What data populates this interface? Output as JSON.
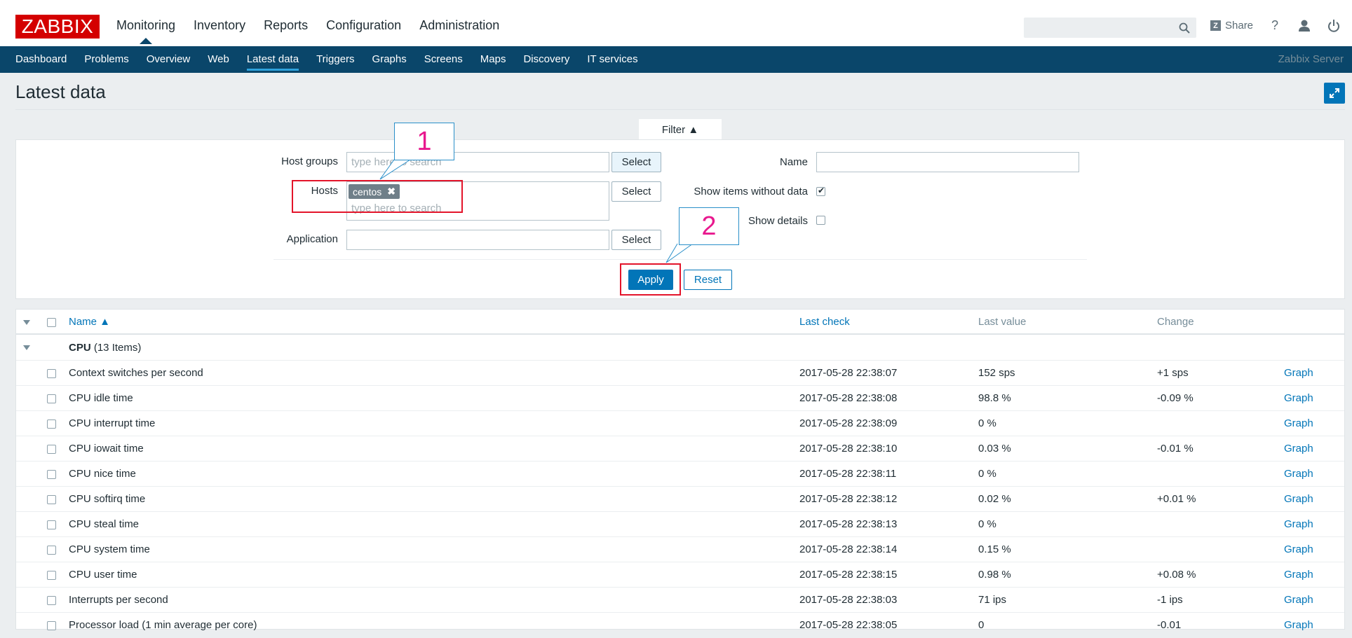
{
  "header": {
    "logo": "ZABBIX",
    "menu": [
      "Monitoring",
      "Inventory",
      "Reports",
      "Configuration",
      "Administration"
    ],
    "share_label": "Share",
    "share_badge": "Z",
    "help_label": "?"
  },
  "subnav": {
    "items": [
      "Dashboard",
      "Problems",
      "Overview",
      "Web",
      "Latest data",
      "Triggers",
      "Graphs",
      "Screens",
      "Maps",
      "Discovery",
      "IT services"
    ],
    "active": "Latest data",
    "server": "Zabbix Server"
  },
  "page": {
    "title": "Latest data"
  },
  "filter": {
    "tab_label": "Filter ▲",
    "host_groups_label": "Host groups",
    "host_groups_placeholder": "type here to search",
    "hosts_label": "Hosts",
    "hosts_tag": "centos",
    "hosts_placeholder": "type here to search",
    "application_label": "Application",
    "application_value": "",
    "select_label": "Select",
    "name_label": "Name",
    "name_value": "",
    "show_without_data_label": "Show items without data",
    "show_without_data_checked": true,
    "show_details_label": "Show details",
    "show_details_checked": false,
    "apply_label": "Apply",
    "reset_label": "Reset"
  },
  "annotations": {
    "callout_1": "1",
    "callout_2": "2"
  },
  "table": {
    "headers": {
      "name": "Name ▲",
      "last_check": "Last check",
      "last_value": "Last value",
      "change": "Change"
    },
    "group": {
      "name": "CPU",
      "count": "(13 Items)"
    },
    "graph_label": "Graph",
    "rows": [
      {
        "name": "Context switches per second",
        "last_check": "2017-05-28 22:38:07",
        "last_value": "152 sps",
        "change": "+1 sps"
      },
      {
        "name": "CPU idle time",
        "last_check": "2017-05-28 22:38:08",
        "last_value": "98.8 %",
        "change": "-0.09 %"
      },
      {
        "name": "CPU interrupt time",
        "last_check": "2017-05-28 22:38:09",
        "last_value": "0 %",
        "change": ""
      },
      {
        "name": "CPU iowait time",
        "last_check": "2017-05-28 22:38:10",
        "last_value": "0.03 %",
        "change": "-0.01 %"
      },
      {
        "name": "CPU nice time",
        "last_check": "2017-05-28 22:38:11",
        "last_value": "0 %",
        "change": ""
      },
      {
        "name": "CPU softirq time",
        "last_check": "2017-05-28 22:38:12",
        "last_value": "0.02 %",
        "change": "+0.01 %"
      },
      {
        "name": "CPU steal time",
        "last_check": "2017-05-28 22:38:13",
        "last_value": "0 %",
        "change": ""
      },
      {
        "name": "CPU system time",
        "last_check": "2017-05-28 22:38:14",
        "last_value": "0.15 %",
        "change": ""
      },
      {
        "name": "CPU user time",
        "last_check": "2017-05-28 22:38:15",
        "last_value": "0.98 %",
        "change": "+0.08 %"
      },
      {
        "name": "Interrupts per second",
        "last_check": "2017-05-28 22:38:03",
        "last_value": "71 ips",
        "change": "-1 ips"
      },
      {
        "name": "Processor load (1 min average per core)",
        "last_check": "2017-05-28 22:38:05",
        "last_value": "0",
        "change": "-0.01"
      }
    ]
  },
  "colors": {
    "brand": "#d40000",
    "nav": "#0a466a",
    "accent": "#0275b8",
    "annotation": "#e3142a",
    "callout_text": "#e8188e"
  }
}
